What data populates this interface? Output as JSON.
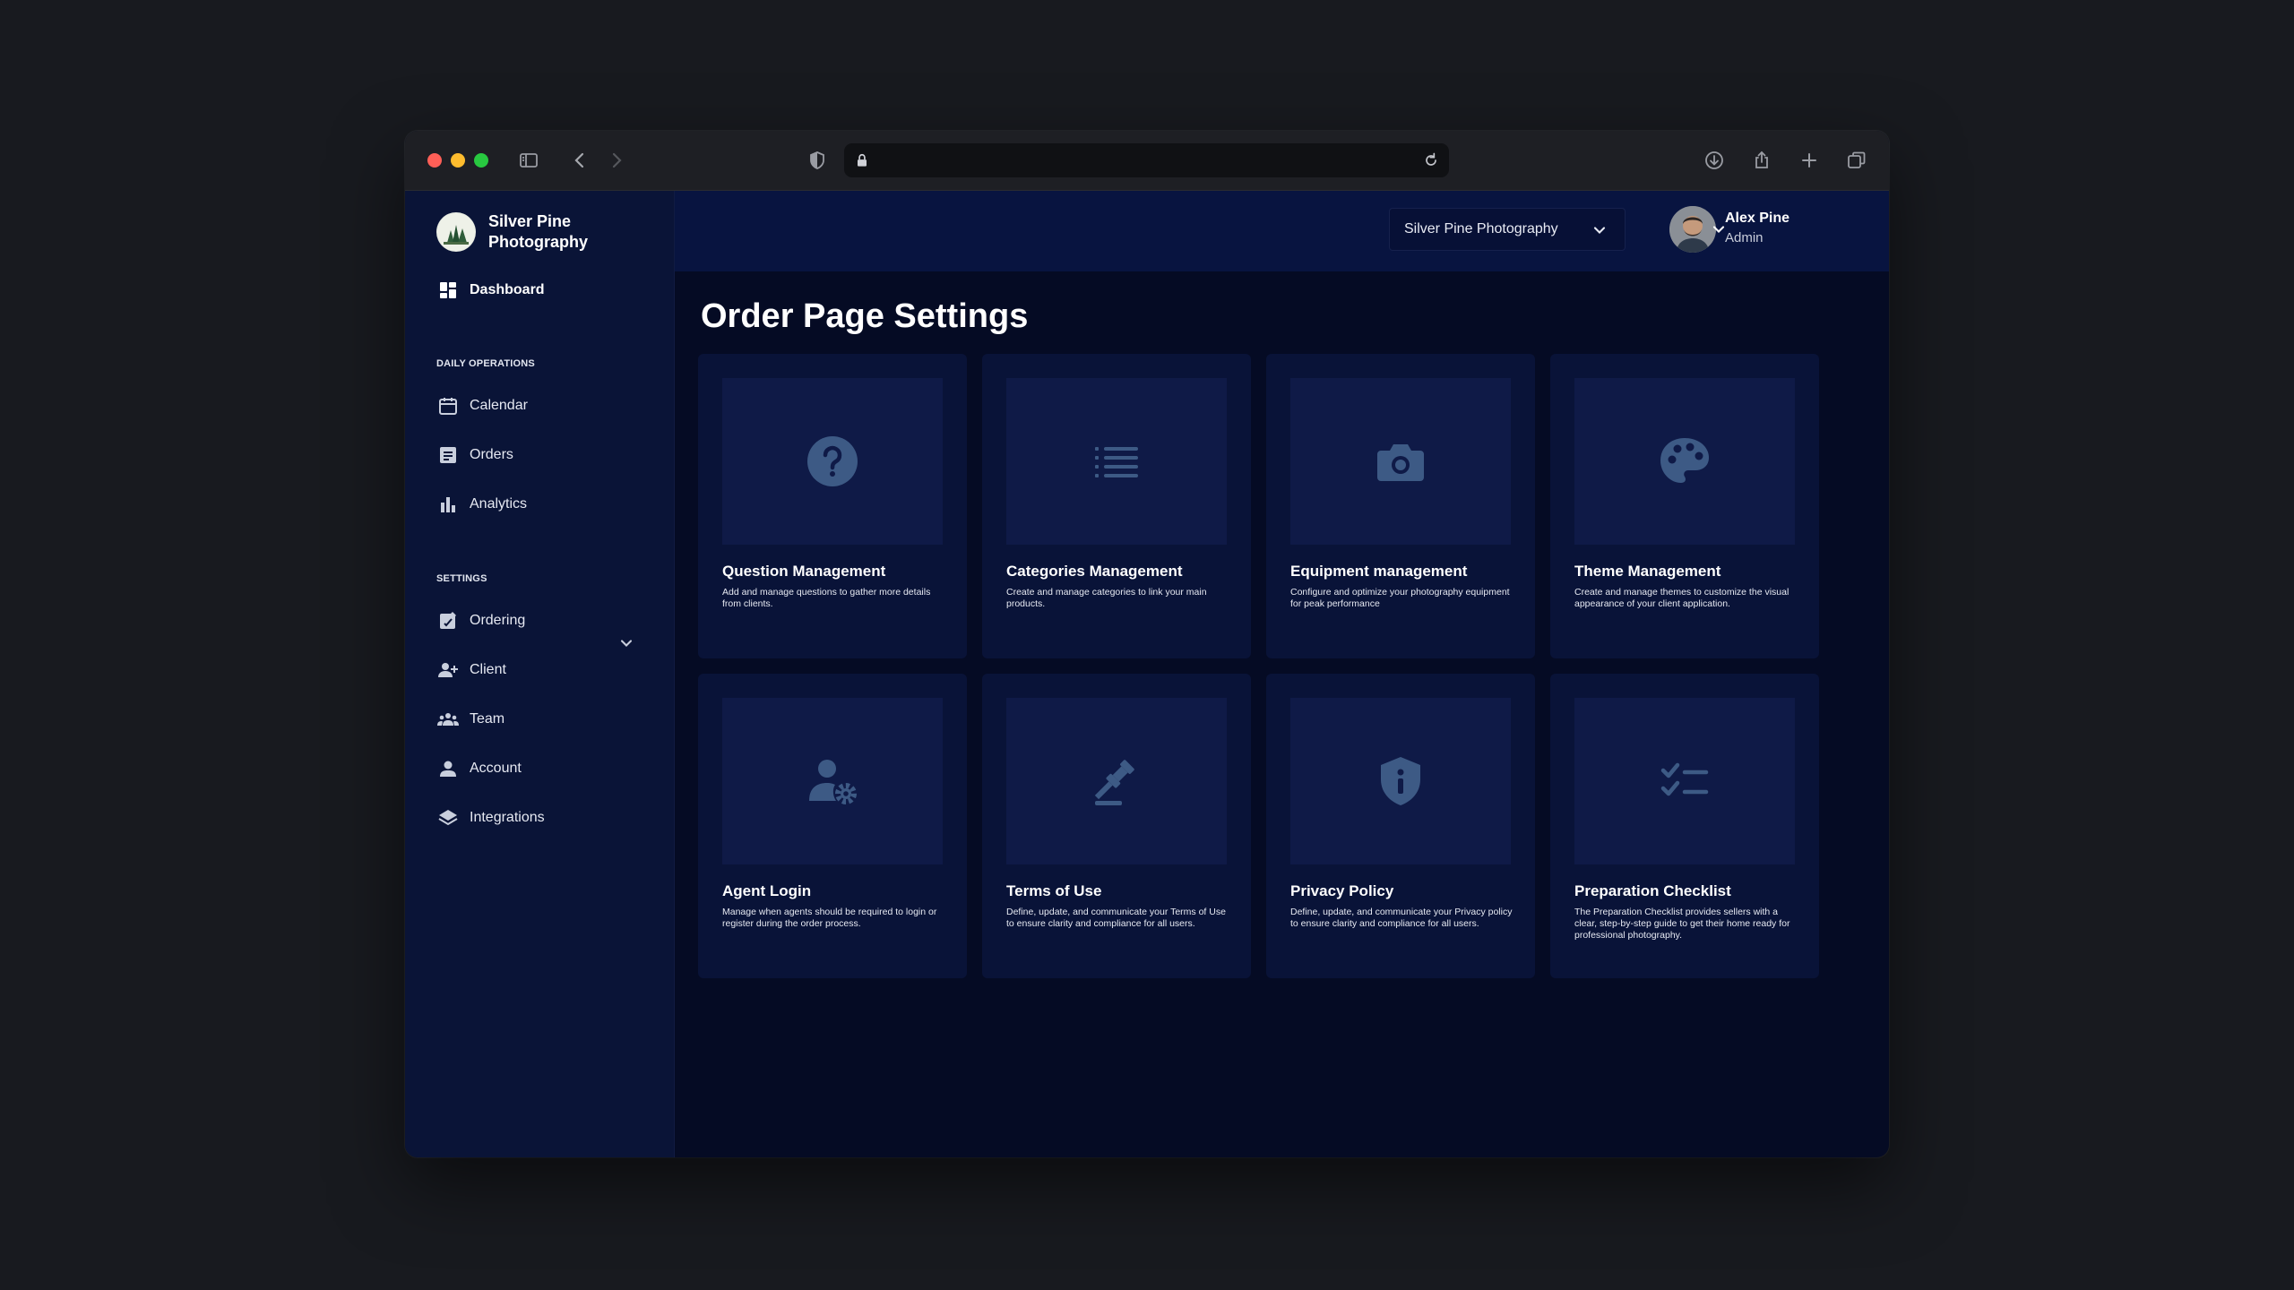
{
  "sidebar": {
    "brand_name": "Silver Pine Photography",
    "dashboard_label": "Dashboard",
    "section_daily": "DAILY OPERATIONS",
    "calendar_label": "Calendar",
    "orders_label": "Orders",
    "analytics_label": "Analytics",
    "section_settings": "SETTINGS",
    "ordering_label": "Ordering",
    "client_label": "Client",
    "team_label": "Team",
    "account_label": "Account",
    "integrations_label": "Integrations"
  },
  "header": {
    "org_select_value": "Silver Pine Photography",
    "user_name": "Alex Pine",
    "user_role": "Admin"
  },
  "main": {
    "title": "Order Page Settings",
    "cards": [
      {
        "title": "Question Management",
        "desc": "Add and manage questions to gather more details from clients.",
        "icon": "question-circle-icon"
      },
      {
        "title": "Categories Management",
        "desc": "Create and manage categories to link your main products.",
        "icon": "list-icon"
      },
      {
        "title": "Equipment management",
        "desc": "Configure and optimize your photography equipment for peak performance",
        "icon": "camera-icon"
      },
      {
        "title": "Theme Management",
        "desc": "Create and manage themes to customize the visual appearance of your client application.",
        "icon": "palette-icon"
      },
      {
        "title": "Agent Login",
        "desc": "Manage when agents should be required to login or register during the order process.",
        "icon": "user-gear-icon"
      },
      {
        "title": "Terms of Use",
        "desc": "Define, update, and communicate your Terms of Use to ensure clarity and compliance for all users.",
        "icon": "gavel-icon"
      },
      {
        "title": "Privacy Policy",
        "desc": "Define, update, and communicate your Privacy policy to ensure clarity and compliance for all users.",
        "icon": "shield-info-icon"
      },
      {
        "title": "Preparation Checklist",
        "desc": "The Preparation Checklist provides sellers with a clear, step-by-step guide to get their home ready for professional photography.",
        "icon": "checklist-icon"
      }
    ]
  },
  "colors": {
    "accent_icon": "#3d5a85",
    "sidebar_bg": "#0a1437",
    "card_bg": "#091338"
  }
}
